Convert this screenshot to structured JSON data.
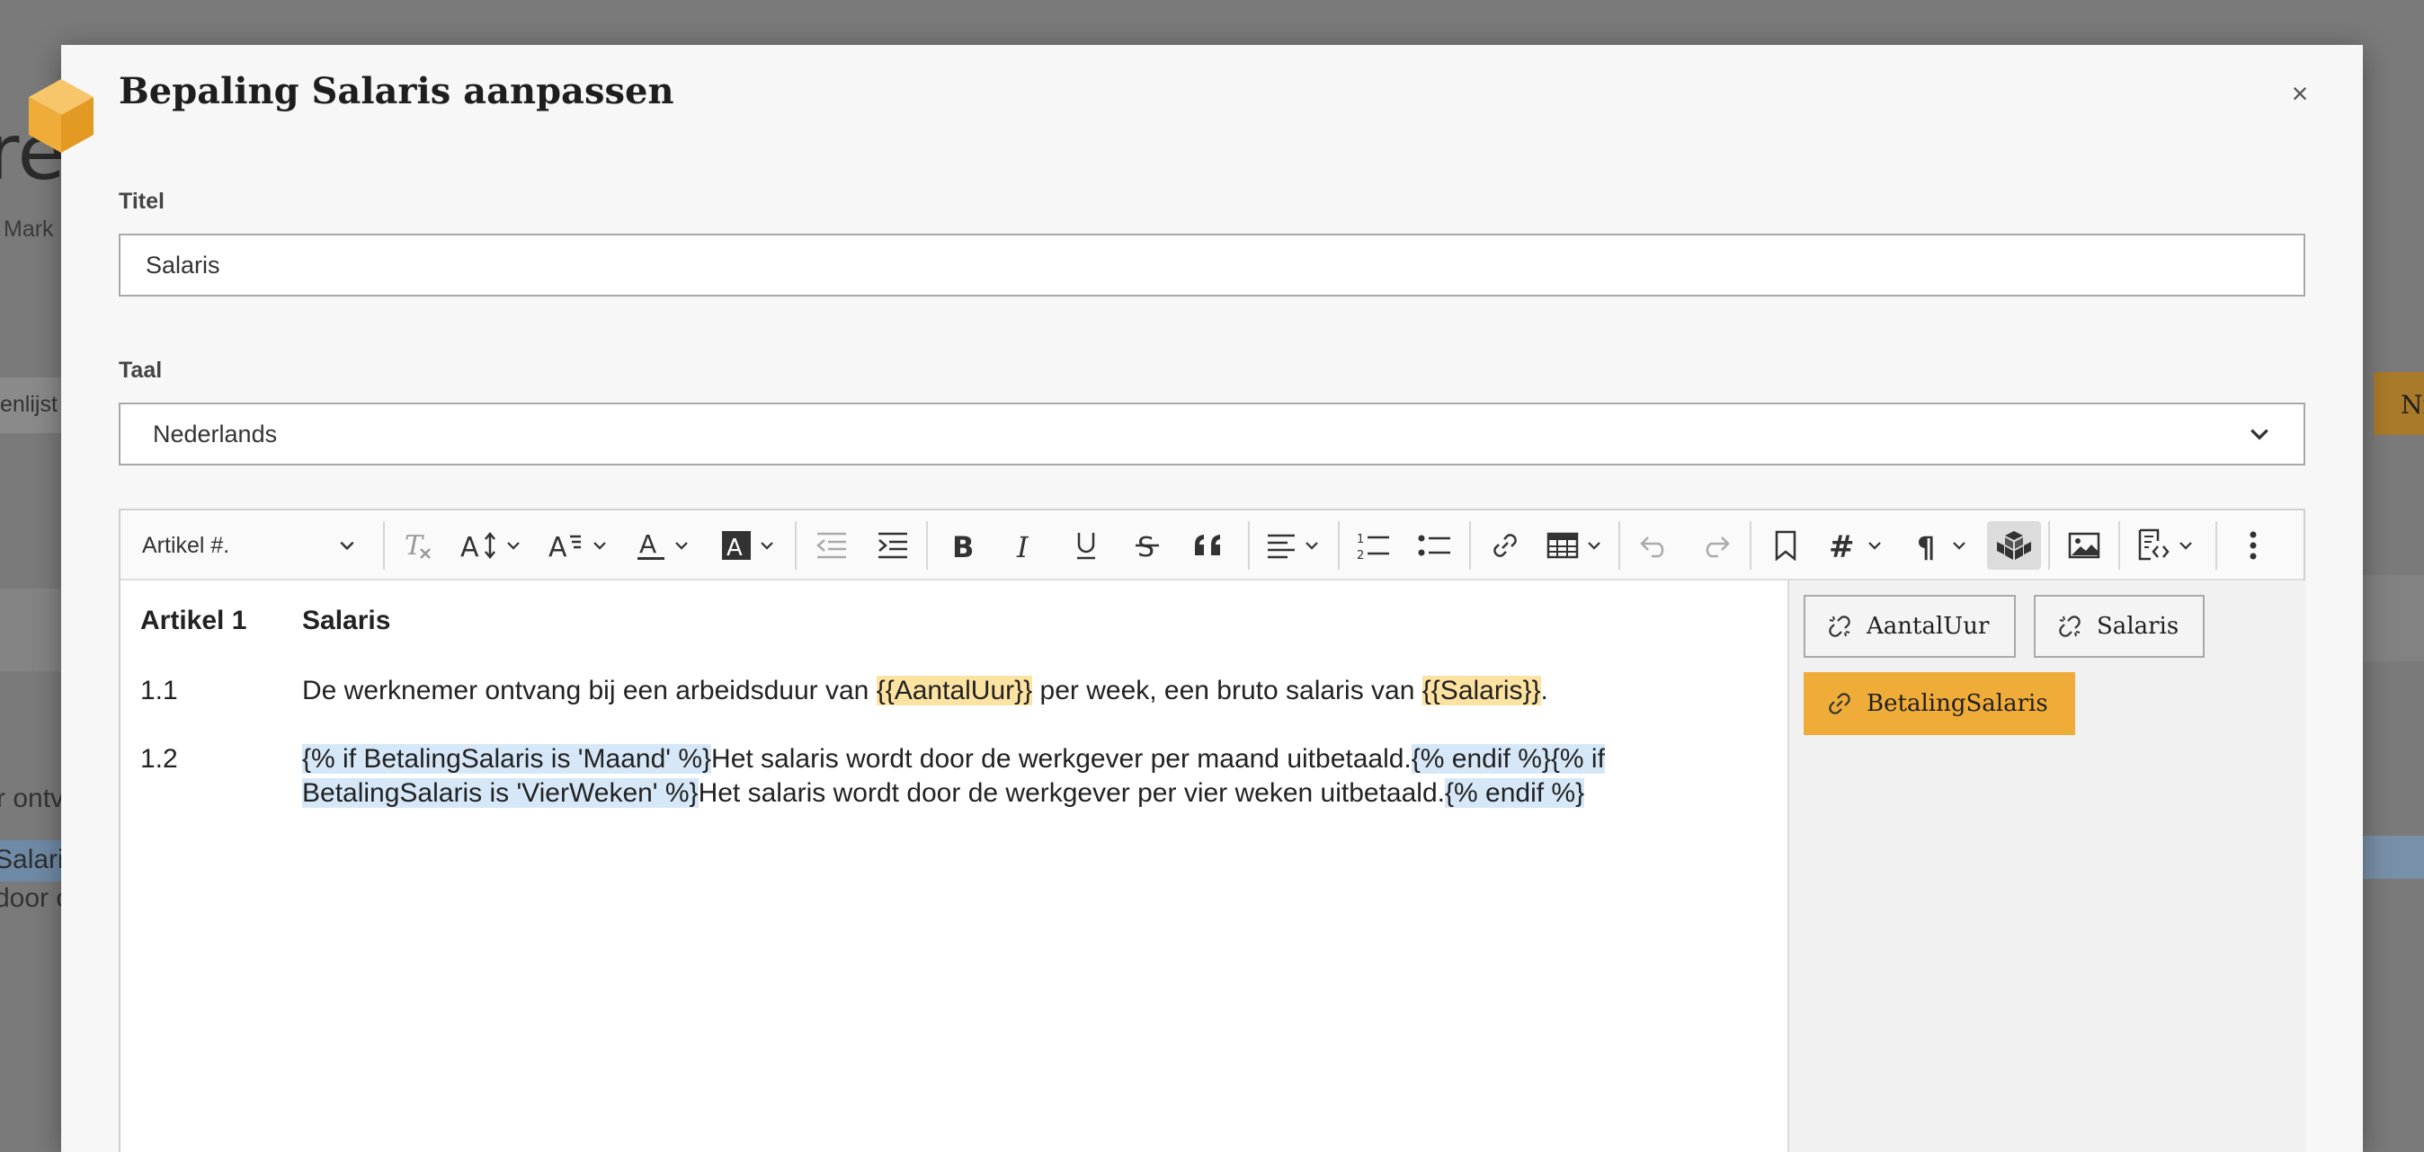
{
  "background": {
    "title_fragment": "re:",
    "subtitle_fragment": "Mark",
    "strip_fragment": "enlijst",
    "text_fragment_1": "r ontv",
    "text_fragment_2": "Salari",
    "text_fragment_3": "door o",
    "right_button_fragment": "Ni"
  },
  "modal": {
    "title": "Bepaling Salaris aanpassen",
    "close_symbol": "×"
  },
  "form": {
    "title_label": "Titel",
    "title_value": "Salaris",
    "language_label": "Taal",
    "language_value": "Nederlands"
  },
  "editor": {
    "heading_select": "Artikel #.",
    "toolbar_icons": [
      "remove-format-icon",
      "font-size-icon",
      "font-family-icon",
      "font-color-icon",
      "font-background-icon",
      "outdent-icon",
      "indent-icon",
      "bold-icon",
      "italic-icon",
      "underline-icon",
      "strikethrough-icon",
      "blockquote-icon",
      "align-icon",
      "numbered-list-icon",
      "bulleted-list-icon",
      "link-icon",
      "table-icon",
      "undo-icon",
      "redo-icon",
      "bookmark-icon",
      "heading-number-icon",
      "paragraph-icon",
      "variables-icon",
      "image-icon",
      "source-icon",
      "more-icon"
    ],
    "article": {
      "number": "Artikel 1",
      "title": "Salaris"
    },
    "paragraphs": [
      {
        "number": "1.1",
        "parts": [
          {
            "text": "De werknemer ontvang bij een arbeidsduur van ",
            "style": "plain"
          },
          {
            "text": "{{AantalUur}}",
            "style": "var"
          },
          {
            "text": " per week, een bruto salaris van ",
            "style": "plain"
          },
          {
            "text": "{{Salaris}}",
            "style": "var"
          },
          {
            "text": ".",
            "style": "plain"
          }
        ]
      },
      {
        "number": "1.2",
        "parts": [
          {
            "text": "{% if BetalingSalaris is 'Maand' %}",
            "style": "cond"
          },
          {
            "text": "Het salaris wordt door de werkgever per maand uitbetaald.",
            "style": "plain"
          },
          {
            "text": "{% endif %}{% if BetalingSalaris is 'VierWeken' %}",
            "style": "cond"
          },
          {
            "text": "Het salaris wordt door de werkgever per vier weken uitbetaald.",
            "style": "plain"
          },
          {
            "text": "{% endif %}",
            "style": "cond"
          }
        ]
      }
    ],
    "variables": [
      {
        "label": "AantalUur",
        "active": false
      },
      {
        "label": "Salaris",
        "active": false
      },
      {
        "label": "BetalingSalaris",
        "active": true
      }
    ]
  },
  "colors": {
    "accent": "#f0ac38",
    "variable_highlight": "#fde3a2",
    "condition_highlight": "#d6e8f8"
  }
}
